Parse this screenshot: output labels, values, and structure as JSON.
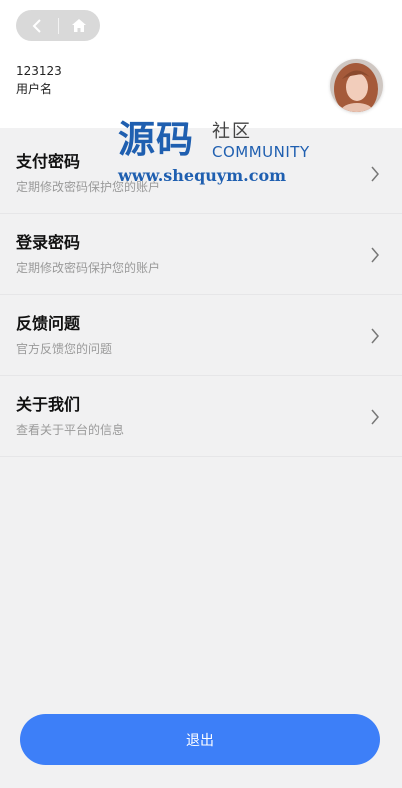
{
  "header": {
    "user_id": "123123",
    "user_name": "用户名"
  },
  "menu": [
    {
      "title": "支付密码",
      "subtitle": "定期修改密码保护您的账户"
    },
    {
      "title": "登录密码",
      "subtitle": "定期修改密码保护您的账户"
    },
    {
      "title": "反馈问题",
      "subtitle": "官方反馈您的问题"
    },
    {
      "title": "关于我们",
      "subtitle": "查看关于平台的信息"
    }
  ],
  "logout_label": "退出",
  "watermark": {
    "main": "源码",
    "side": "社区",
    "community": "COMMUNITY",
    "url": "www.shequym.com"
  },
  "colors": {
    "accent": "#3d7ff8",
    "background": "#f1f1f2"
  }
}
